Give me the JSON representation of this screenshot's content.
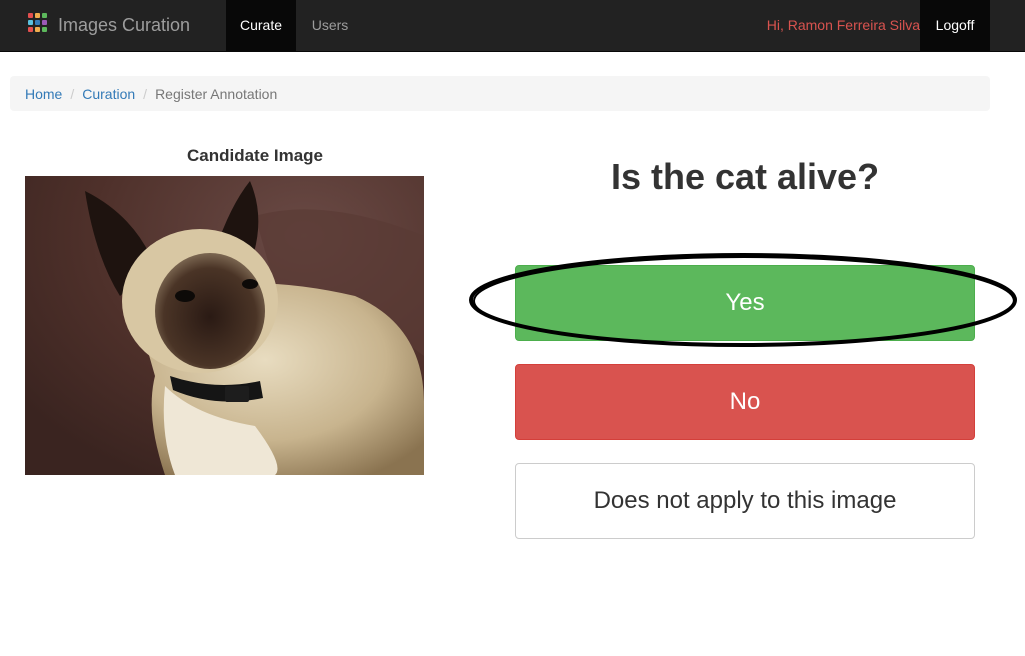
{
  "navbar": {
    "brand": "Images Curation",
    "brand_colors": [
      "#e34f4f",
      "#f0ad4e",
      "#5cb85c",
      "#5bc0de",
      "#337ab7",
      "#9b59b6",
      "#e34f4f",
      "#f0ad4e",
      "#5cb85c"
    ],
    "items": [
      {
        "label": "Curate",
        "active": true
      },
      {
        "label": "Users",
        "active": false
      }
    ],
    "greeting": "Hi, Ramon Ferreira Silva",
    "logoff": "Logoff"
  },
  "breadcrumb": {
    "items": [
      "Home",
      "Curation"
    ],
    "active": "Register Annotation"
  },
  "candidate": {
    "title": "Candidate Image"
  },
  "question": {
    "text": "Is the cat alive?",
    "options": {
      "yes": "Yes",
      "no": "No",
      "not_apply": "Does not apply to this image"
    }
  },
  "colors": {
    "success": "#5cb85c",
    "danger": "#d9534f",
    "link": "#337ab7",
    "navbar": "#222222"
  }
}
